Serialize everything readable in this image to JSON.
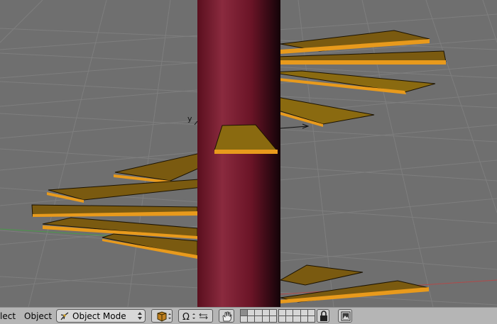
{
  "viewport": {
    "axis_y_label": "y",
    "colors": {
      "background": "#6f6f6f",
      "grid": "#808080",
      "column": "#7a1a2e",
      "step_top": "#8a6a10",
      "step_edge": "#f0a020"
    }
  },
  "header": {
    "select_menu": "lect",
    "object_menu": "Object",
    "mode_label": "Object Mode",
    "mode_icon": "object-mode-icon",
    "draw_type_icon": "solid-cube-icon",
    "pivot_icon": "rotate-arrows-icon",
    "transform_manipulator_icons": [
      "omega-rotate-icon",
      "translate-widget-icon"
    ],
    "hand_icon": "hand-icon",
    "lock_icon": "lock-icon",
    "render_icon": "render-image-icon"
  }
}
